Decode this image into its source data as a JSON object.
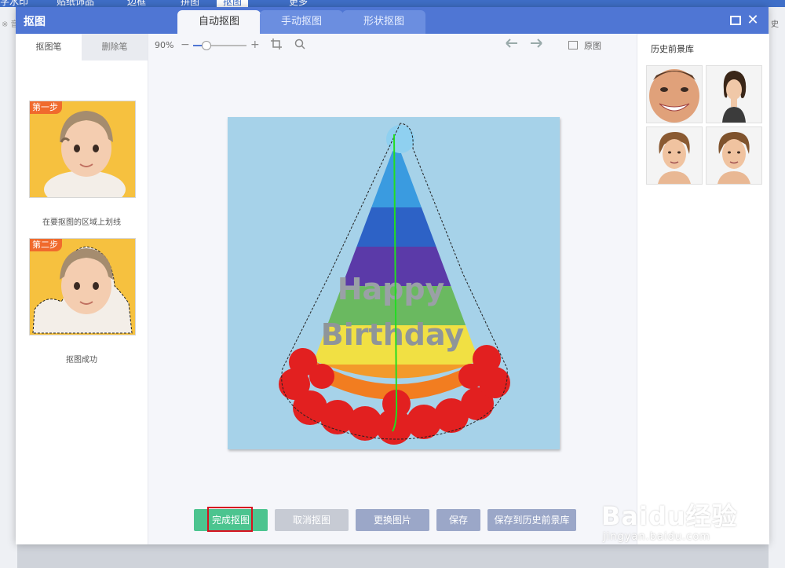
{
  "background_app": {
    "tabs": [
      "字水印",
      "贴纸饰品",
      "边框",
      "拼图",
      "抠图",
      "更多"
    ],
    "active_tab_index": 4,
    "right_edge_text": "史",
    "left_edge_text": "※ 音"
  },
  "window": {
    "title": "抠图",
    "mode_tabs": [
      {
        "label": "自动抠图",
        "active": true
      },
      {
        "label": "手动抠图",
        "active": false
      },
      {
        "label": "形状抠图",
        "active": false
      }
    ]
  },
  "left_panel": {
    "pen_tabs": [
      "抠图笔",
      "删除笔"
    ],
    "steps": [
      {
        "badge": "第一步",
        "caption": "在要抠图的区域上划线"
      },
      {
        "badge": "第二步",
        "caption": "抠图成功"
      }
    ]
  },
  "toolbar": {
    "zoom_percent": "90%",
    "zoom_slider_level": 0.25,
    "original_label": "原图"
  },
  "buttons": {
    "done": "完成抠图",
    "cancel": "取消抠图",
    "replace": "更换图片",
    "save": "保存",
    "save_history": "保存到历史前景库"
  },
  "right_panel": {
    "title": "历史前景库"
  },
  "canvas": {
    "hat_text_line1": "Happy",
    "hat_text_line2": "Birthday"
  },
  "watermark": {
    "main": "Baidu经验",
    "sub": "jingyan.baidu.com"
  },
  "colors": {
    "titlebar": "#4f76d4",
    "done_button": "#4cc48f",
    "secondary_button": "#9ba7c8",
    "canvas_bg": "#a6d2e9"
  }
}
